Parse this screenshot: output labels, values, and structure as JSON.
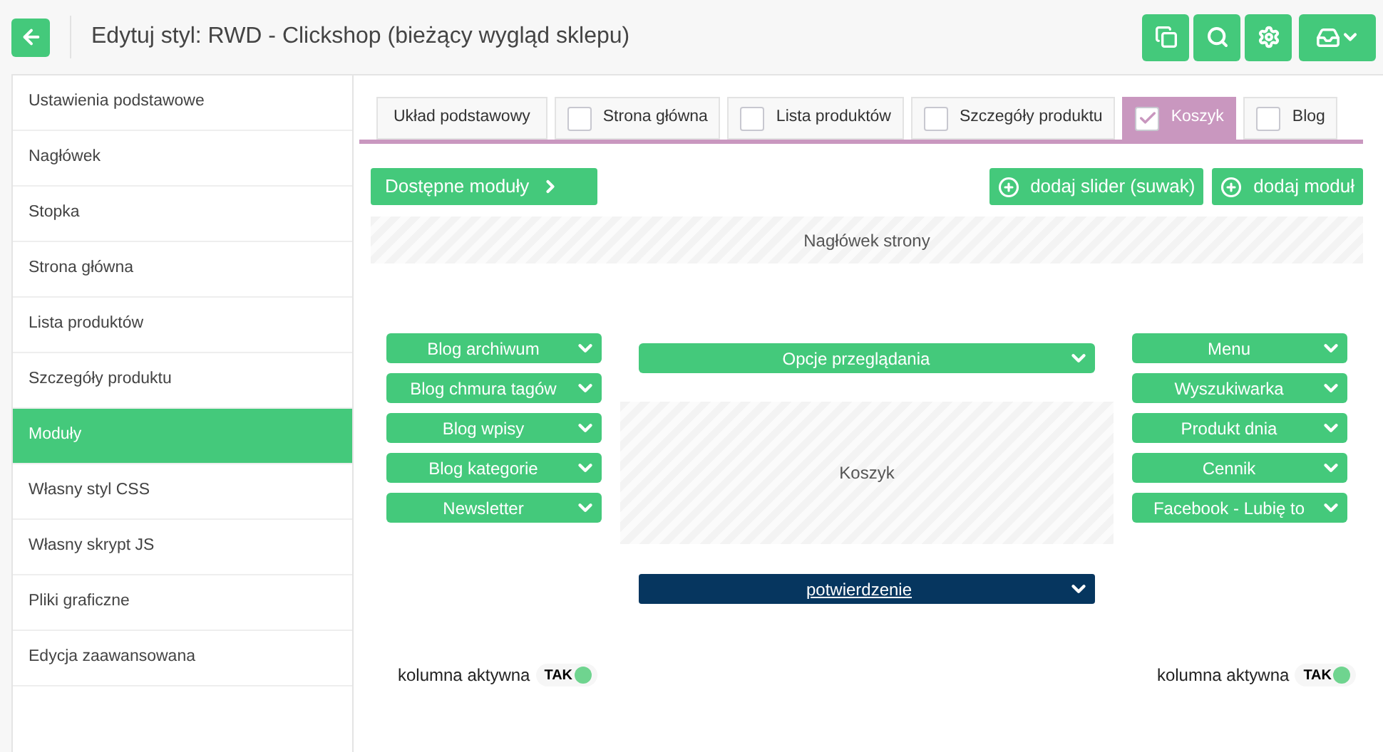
{
  "header": {
    "title": "Edytuj styl: RWD - Clickshop (bieżący wygląd sklepu)"
  },
  "sidebar": {
    "items": [
      {
        "label": "Ustawienia podstawowe",
        "selected": false
      },
      {
        "label": "Nagłówek",
        "selected": false
      },
      {
        "label": "Stopka",
        "selected": false
      },
      {
        "label": "Strona główna",
        "selected": false
      },
      {
        "label": "Lista produktów",
        "selected": false
      },
      {
        "label": "Szczegóły produktu",
        "selected": false
      },
      {
        "label": "Moduły",
        "selected": true
      },
      {
        "label": "Własny styl CSS",
        "selected": false
      },
      {
        "label": "Własny skrypt JS",
        "selected": false
      },
      {
        "label": "Pliki graficzne",
        "selected": false
      },
      {
        "label": "Edycja zaawansowana",
        "selected": false
      }
    ]
  },
  "tabs": [
    {
      "label": "Układ podstawowy",
      "kind": "plain",
      "selected": false
    },
    {
      "label": "Strona główna",
      "kind": "checkbox",
      "checked": false,
      "selected": false
    },
    {
      "label": "Lista produktów",
      "kind": "checkbox",
      "checked": false,
      "selected": false
    },
    {
      "label": "Szczegóły produktu",
      "kind": "checkbox",
      "checked": false,
      "selected": false
    },
    {
      "label": "Koszyk",
      "kind": "checkbox",
      "checked": true,
      "selected": true
    },
    {
      "label": "Blog",
      "kind": "checkbox",
      "checked": false,
      "selected": false
    }
  ],
  "toolbar": {
    "available": "Dostępne moduły",
    "add_slider": "dodaj slider (suwak)",
    "add_module": "dodaj moduł"
  },
  "page_header": "Nagłówek strony",
  "left_column": {
    "modules": [
      "Blog archiwum",
      "Blog chmura tagów",
      "Blog wpisy",
      "Blog kategorie",
      "Newsletter"
    ],
    "toggle_label": "kolumna aktywna",
    "toggle_text": "TAK",
    "on": true
  },
  "center_column": {
    "items": [
      {
        "kind": "module",
        "label": "Opcje przeglądania"
      },
      {
        "kind": "slot",
        "label": "Koszyk"
      },
      {
        "kind": "current",
        "label": "potwierdzenie"
      }
    ]
  },
  "right_column": {
    "modules": [
      "Menu",
      "Wyszukiwarka",
      "Produkt dnia",
      "Cennik",
      "Facebook - Lubię to"
    ],
    "toggle_label": "kolumna aktywna",
    "toggle_text": "TAK",
    "on": true
  }
}
